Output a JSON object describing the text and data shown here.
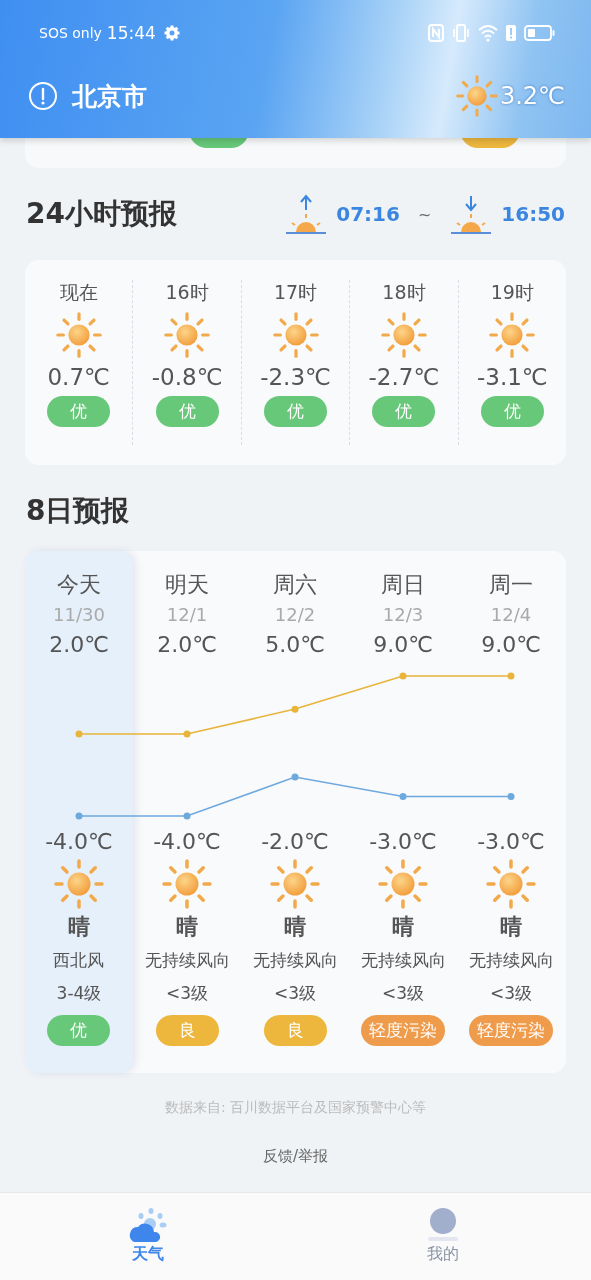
{
  "status_bar": {
    "carrier": "SOS only",
    "time": "15:44"
  },
  "header": {
    "city": "北京市",
    "temperature": "3.2℃"
  },
  "top_card": {
    "badges": [
      {
        "color": "#66c878"
      },
      {
        "color": "#edb73e"
      }
    ]
  },
  "hourly": {
    "title": "24小时预报",
    "sunrise": "07:16",
    "separator": "~",
    "sunset": "16:50",
    "hours": [
      {
        "time": "现在",
        "temperature": "0.7℃",
        "aqi": "优",
        "color": "#66c878"
      },
      {
        "time": "16时",
        "temperature": "-0.8℃",
        "aqi": "优",
        "color": "#66c878"
      },
      {
        "time": "17时",
        "temperature": "-2.3℃",
        "aqi": "优",
        "color": "#66c878"
      },
      {
        "time": "18时",
        "temperature": "-2.7℃",
        "aqi": "优",
        "color": "#66c878"
      },
      {
        "time": "19时",
        "temperature": "-3.1℃",
        "aqi": "优",
        "color": "#66c878"
      }
    ]
  },
  "daily": {
    "title": "8日预报",
    "days": [
      {
        "day": "今天",
        "date": "11/30",
        "high": "2.0℃",
        "low": "-4.0℃",
        "condition": "晴",
        "wind_direction": "西北风",
        "wind_level": "3-4级",
        "aqi": "优",
        "color": "#66c878",
        "selected": true
      },
      {
        "day": "明天",
        "date": "12/1",
        "high": "2.0℃",
        "low": "-4.0℃",
        "condition": "晴",
        "wind_direction": "无持续风向",
        "wind_level": "<3级",
        "aqi": "良",
        "color": "#edb73e",
        "selected": false
      },
      {
        "day": "周六",
        "date": "12/2",
        "high": "5.0℃",
        "low": "-2.0℃",
        "condition": "晴",
        "wind_direction": "无持续风向",
        "wind_level": "<3级",
        "aqi": "良",
        "color": "#edb73e",
        "selected": false
      },
      {
        "day": "周日",
        "date": "12/3",
        "high": "9.0℃",
        "low": "-3.0℃",
        "condition": "晴",
        "wind_direction": "无持续风向",
        "wind_level": "<3级",
        "aqi": "轻度污染",
        "color": "#ee9b4c",
        "selected": false
      },
      {
        "day": "周一",
        "date": "12/4",
        "high": "9.0℃",
        "low": "-3.0℃",
        "condition": "晴",
        "wind_direction": "无持续风向",
        "wind_level": "<3级",
        "aqi": "轻度污染",
        "color": "#ee9b4c",
        "selected": false
      }
    ]
  },
  "footer": {
    "source": "数据来自: 百川数据平台及国家预警中心等",
    "feedback": "反馈/举报"
  },
  "tabs": [
    {
      "label": "天气",
      "kind": "weather",
      "selected": true
    },
    {
      "label": "我的",
      "kind": "profile",
      "selected": false
    }
  ]
}
